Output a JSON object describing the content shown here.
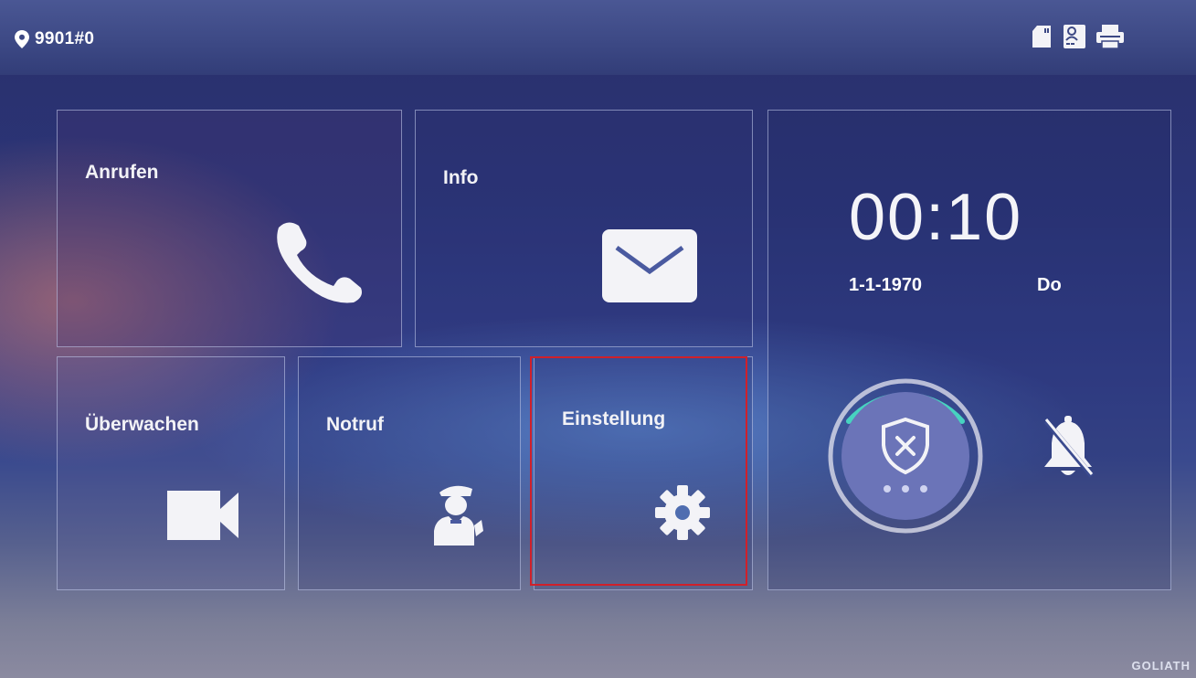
{
  "header": {
    "location_icon": "location-pin-icon",
    "device_id": "9901#0",
    "status_icons": [
      "sd-card-icon",
      "contact-card-icon",
      "printer-icon"
    ]
  },
  "tiles": {
    "call": {
      "label": "Anrufen",
      "icon": "phone-icon"
    },
    "info": {
      "label": "Info",
      "icon": "envelope-icon"
    },
    "monitor": {
      "label": "Überwachen",
      "icon": "video-camera-icon"
    },
    "emergency": {
      "label": "Notruf",
      "icon": "guard-icon"
    },
    "settings": {
      "label": "Einstellung",
      "icon": "gear-icon"
    }
  },
  "clock_panel": {
    "time": "00:10",
    "date": "1-1-1970",
    "weekday": "Do",
    "arm_button_icon": "shield-x-icon",
    "bell_icon": "bell-muted-icon"
  },
  "brand": "GOLIATH",
  "colors": {
    "highlight": "#d0202a",
    "ring_accent": "#47d3c0",
    "icon_fill": "#f3f3f7"
  }
}
